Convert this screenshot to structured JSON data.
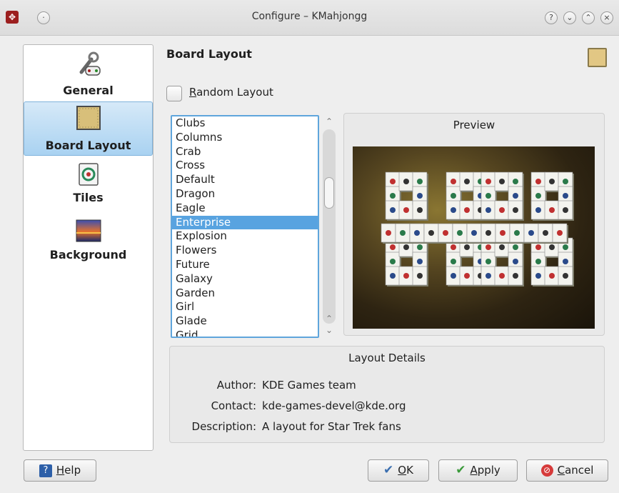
{
  "window": {
    "title": "Configure – KMahjongg"
  },
  "sidebar": {
    "items": [
      {
        "label": "General"
      },
      {
        "label": "Board Layout"
      },
      {
        "label": "Tiles"
      },
      {
        "label": "Background"
      }
    ]
  },
  "main": {
    "section_title": "Board Layout",
    "random_layout_label_prefix": "R",
    "random_layout_label_rest": "andom Layout",
    "random_layout_checked": false,
    "layouts": [
      "Clubs",
      "Columns",
      "Crab",
      "Cross",
      "Default",
      "Dragon",
      "Eagle",
      "Enterprise",
      "Explosion",
      "Flowers",
      "Future",
      "Galaxy",
      "Garden",
      "Girl",
      "Glade",
      "Grid"
    ],
    "selected_layout": "Enterprise",
    "preview_label": "Preview",
    "details": {
      "title": "Layout Details",
      "author_label": "Author:",
      "author_value": "KDE Games team",
      "contact_label": "Contact:",
      "contact_value": "kde-games-devel@kde.org",
      "description_label": "Description:",
      "description_value": "A layout for Star Trek fans"
    }
  },
  "buttons": {
    "help_prefix": "H",
    "help_rest": "elp",
    "ok_prefix": "O",
    "ok_rest": "K",
    "apply_prefix": "A",
    "apply_rest": "pply",
    "cancel_prefix": "C",
    "cancel_rest": "ancel"
  },
  "colors": {
    "selection": "#58a3e0",
    "sidebar_selected": "#a9d2f1",
    "cancel_icon": "#d63a3a",
    "check_icon": "#3b6fb0"
  }
}
